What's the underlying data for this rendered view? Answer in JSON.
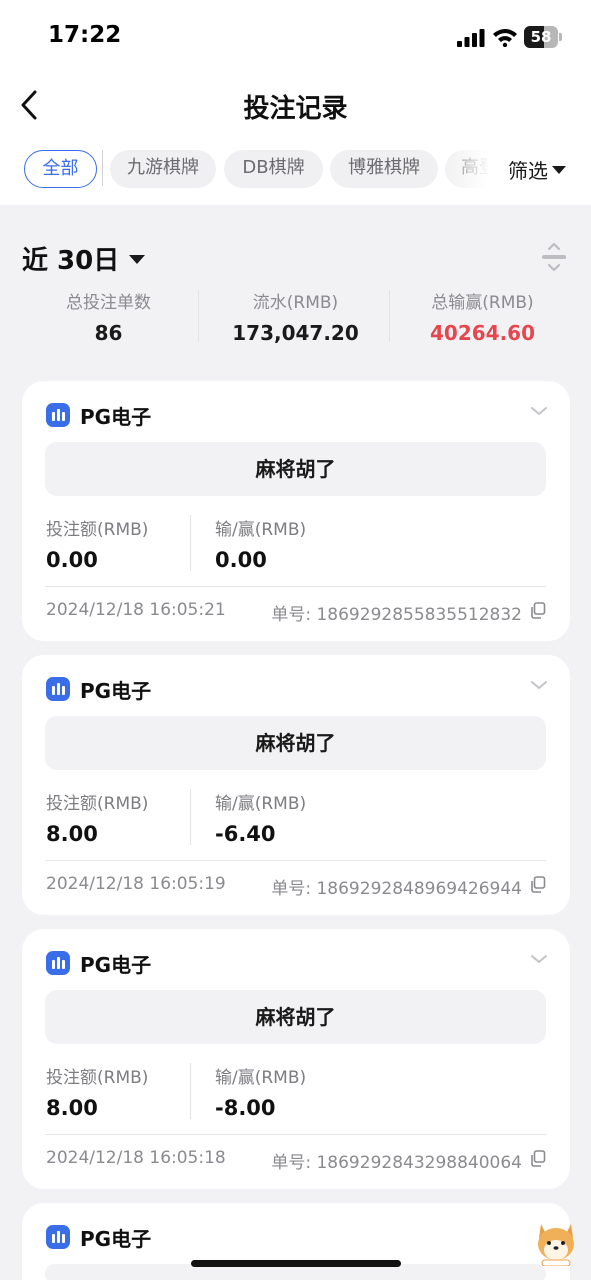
{
  "status_bar": {
    "time": "17:22",
    "battery": "58"
  },
  "nav": {
    "title": "投注记录",
    "back_icon": "chevron-left-icon"
  },
  "tabs": [
    {
      "label": "全部"
    },
    {
      "label": "九游棋牌"
    },
    {
      "label": "DB棋牌"
    },
    {
      "label": "博雅棋牌"
    },
    {
      "label": "高登"
    }
  ],
  "filter": {
    "label": "筛选"
  },
  "period": {
    "label": "近 30日"
  },
  "stats": [
    {
      "label": "总投注单数",
      "value": "86"
    },
    {
      "label": "流水(RMB)",
      "value": "173,047.20"
    },
    {
      "label": "总输赢(RMB)",
      "value": "40264.60"
    }
  ],
  "colors": {
    "accent": "#3a6ee8",
    "loss": "#e5474f"
  },
  "records": [
    {
      "provider": "PG电子",
      "game": "麻将胡了",
      "bet_label": "投注额(RMB)",
      "bet": "0.00",
      "win_label": "输/赢(RMB)",
      "win": "0.00",
      "time": "2024/12/18 16:05:21",
      "order_label": "单号:",
      "order_no": "1869292855835512832"
    },
    {
      "provider": "PG电子",
      "game": "麻将胡了",
      "bet_label": "投注额(RMB)",
      "bet": "8.00",
      "win_label": "输/赢(RMB)",
      "win": "-6.40",
      "time": "2024/12/18 16:05:19",
      "order_label": "单号:",
      "order_no": "1869292848969426944"
    },
    {
      "provider": "PG电子",
      "game": "麻将胡了",
      "bet_label": "投注额(RMB)",
      "bet": "8.00",
      "win_label": "输/赢(RMB)",
      "win": "-8.00",
      "time": "2024/12/18 16:05:18",
      "order_label": "单号:",
      "order_no": "1869292843298840064"
    },
    {
      "provider": "PG电子"
    }
  ]
}
